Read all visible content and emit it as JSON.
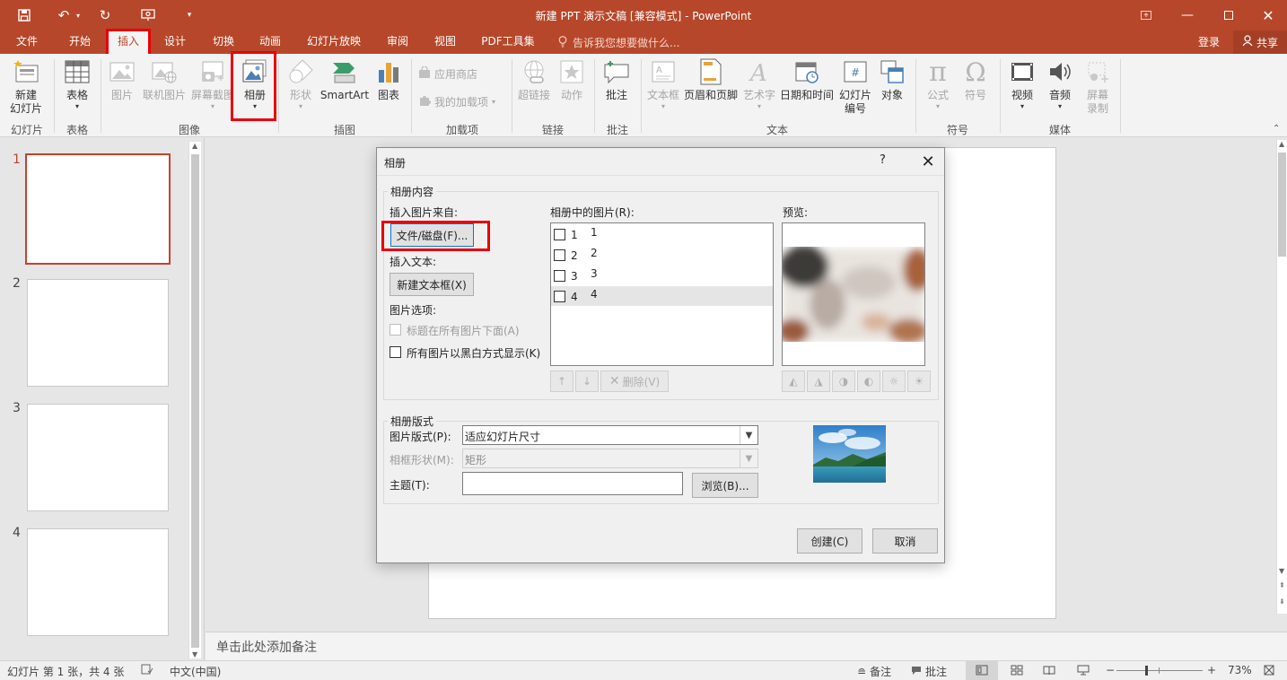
{
  "window": {
    "title": "新建 PPT 演示文稿 [兼容模式] - PowerPoint"
  },
  "menu": {
    "tabs": [
      "文件",
      "开始",
      "插入",
      "设计",
      "切换",
      "动画",
      "幻灯片放映",
      "审阅",
      "视图",
      "PDF工具集"
    ],
    "active_tab": "插入",
    "tell_me": "告诉我您想要做什么...",
    "login": "登录",
    "share": "共享"
  },
  "ribbon": {
    "new_slide": "新建\n幻灯片",
    "table": "表格",
    "picture": "图片",
    "online_picture": "联机图片",
    "screenshot": "屏幕截图",
    "album": "相册",
    "shapes": "形状",
    "smartart": "SmartArt",
    "chart": "图表",
    "store": "应用商店",
    "my_addins": "我的加载项",
    "hyperlink": "超链接",
    "action": "动作",
    "comment": "批注",
    "textbox": "文本框",
    "header_footer": "页眉和页脚",
    "wordart": "艺术字",
    "datetime": "日期和时间",
    "slide_number": "幻灯片\n编号",
    "object": "对象",
    "equation": "公式",
    "symbol": "符号",
    "video": "视频",
    "audio": "音频",
    "screen_record": "屏幕\n录制",
    "groups": {
      "slides": "幻灯片",
      "tables": "表格",
      "images": "图像",
      "illustrations": "插图",
      "addins": "加载项",
      "links": "链接",
      "comments": "批注",
      "text": "文本",
      "symbols": "符号",
      "media": "媒体"
    }
  },
  "thumbnails": [
    {
      "num": "1",
      "active": true
    },
    {
      "num": "2",
      "active": false
    },
    {
      "num": "3",
      "active": false
    },
    {
      "num": "4",
      "active": false
    }
  ],
  "notes_placeholder": "单击此处添加备注",
  "status": {
    "slide_info": "幻灯片 第 1 张，共 4 张",
    "language": "中文(中国)",
    "notes": "备注",
    "comments": "批注",
    "zoom": "73%"
  },
  "dialog": {
    "title": "相册",
    "help": "?",
    "content_section": "相册内容",
    "insert_from": "插入图片来自:",
    "file_disk_button": "文件/磁盘(F)...",
    "insert_text": "插入文本:",
    "new_textbox_button": "新建文本框(X)",
    "picture_options": "图片选项:",
    "caption_below": "标题在所有图片下面(A)",
    "black_white": "所有图片以黑白方式显示(K)",
    "pictures_in_album": "相册中的图片(R):",
    "pictures": [
      {
        "index": "1",
        "name": "1"
      },
      {
        "index": "2",
        "name": "2"
      },
      {
        "index": "3",
        "name": "3"
      },
      {
        "index": "4",
        "name": "4"
      }
    ],
    "selected_index": 3,
    "delete_button": "删除(V)",
    "preview": "预览:",
    "layout_section": "相册版式",
    "picture_layout_label": "图片版式(P):",
    "picture_layout_value": "适应幻灯片尺寸",
    "frame_shape_label": "相框形状(M):",
    "frame_shape_value": "矩形",
    "theme_label": "主题(T):",
    "theme_value": "",
    "browse_button": "浏览(B)...",
    "create_button": "创建(C)",
    "cancel_button": "取消"
  },
  "colors": {
    "accent": "#b7472a",
    "highlight": "#e8000b"
  }
}
